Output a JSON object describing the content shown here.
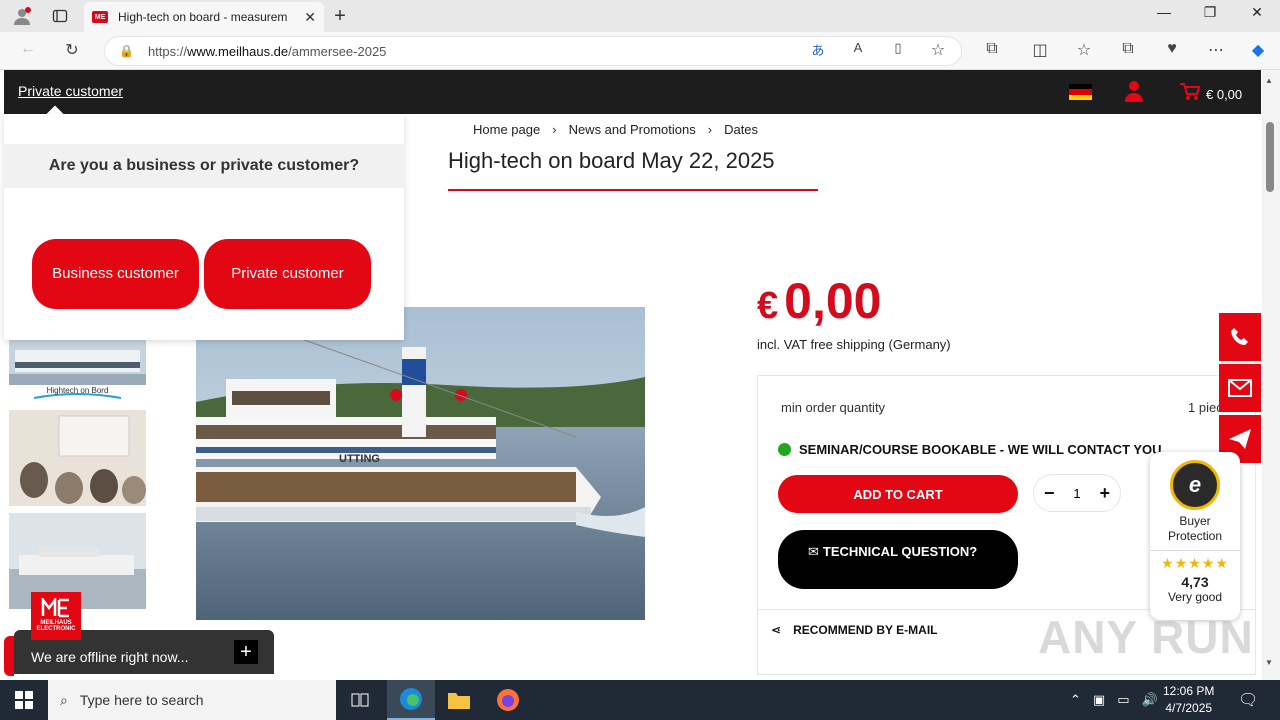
{
  "browser": {
    "tab_title": "High-tech on board - measurem",
    "tab_favicon": "ME",
    "url_scheme": "https://",
    "url_host": "www.meilhaus.de",
    "url_path": "/ammersee-2025"
  },
  "site_header": {
    "private_customer_link": "Private customer",
    "cart_total": "€ 0,00"
  },
  "popup": {
    "question": "Are you a business or private customer?",
    "business_button": "Business customer",
    "private_button": "Private customer"
  },
  "breadcrumb": [
    "Home page",
    "News and Promotions",
    "Dates"
  ],
  "page_title": "High-tech on board May 22, 2025",
  "thumbnail_caption": "Hightech on Bord",
  "ship_name": "UTTING",
  "product": {
    "currency": "€",
    "price": "0,00",
    "vat_note": "incl. VAT free shipping (Germany)",
    "min_order_label": "min order quantity",
    "min_order_value": "1 piece",
    "status": "SEMINAR/COURSE BOOKABLE - WE WILL CONTACT YOU",
    "add_to_cart": "ADD TO CART",
    "quantity": "1",
    "technical_question": "TECHNICAL QUESTION?",
    "recommend": "RECOMMEND BY E-MAIL"
  },
  "trust_badge": {
    "title": "Buyer Protection",
    "stars": "★★★★★",
    "score": "4,73",
    "rating": "Very good"
  },
  "chat": {
    "status": "We are offline right now...",
    "logo_text": "MEILHAUS ELECTRONIC"
  },
  "watermark": "ANY RUN",
  "taskbar": {
    "search_placeholder": "Type here to search",
    "time": "12:06 PM",
    "date": "4/7/2025"
  },
  "colors": {
    "brand_red": "#e30613",
    "header_dark": "#1d1d1d",
    "status_green": "#1fa81f"
  }
}
